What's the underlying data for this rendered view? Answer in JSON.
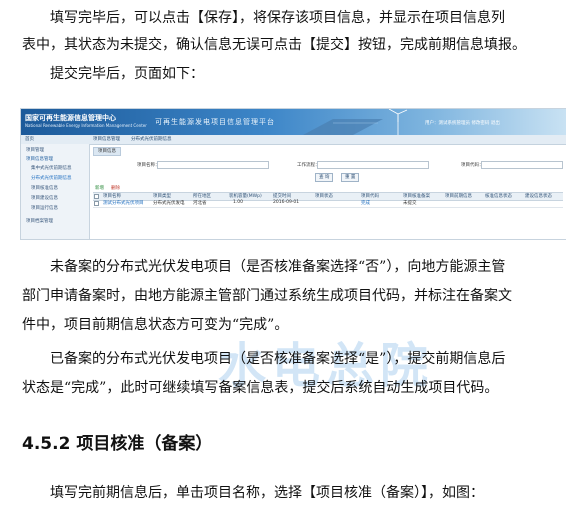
{
  "paragraphs": {
    "p1_line1": "填写完毕后，可以点击【保存】，将保存该项目信息，并显示在项目信息列",
    "p1_line2": "表中，其状态为未提交，确认信息无误可点击【提交】按钮，完成前期信息填报。",
    "p2": "提交完毕后，页面如下：",
    "p3_line1": "未备案的分布式光伏发电项目（是否核准备案选择“否”），向地方能源主管",
    "p3_line2": "部门申请备案时，由地方能源主管部门通过系统生成项目代码，并标注在备案文",
    "p3_line3": "件中，项目前期信息状态方可变为“完成”。",
    "p4_line1": "已备案的分布式光伏发电项目（是否核准备案选择“是”），提交前期信息后",
    "p4_line2": "状态是“完成”，此时可继续填写备案信息表，提交后系统自动生成项目代码。",
    "heading": "4.5.2 项目核准（备案）",
    "p5": "填写完前期信息后，单击项目名称，选择【项目核准（备案）】，如图："
  },
  "watermark": "水电总院",
  "screenshot": {
    "banner_title": "国家可再生能源信息管理中心",
    "banner_subtitle": "National Renewable Energy Information Management Center",
    "banner_slogan": "可再生能源发电项目信息管理平台",
    "banner_user": "用户：测试系统管理员",
    "banner_links": "修改密码  退出",
    "nav_home": "首页",
    "nav_info": "项目信息管理",
    "nav_current": "分布式光伏前期信息",
    "sidebar": [
      {
        "label": "项目管理",
        "state": "header"
      },
      {
        "label": "项目信息管理",
        "state": "header"
      },
      {
        "label": "集中式光伏前期信息",
        "state": "sub"
      },
      {
        "label": "分布式光伏前期信息",
        "state": "active"
      },
      {
        "label": "项目核准信息",
        "state": "sub"
      },
      {
        "label": "项目建设信息",
        "state": "sub"
      },
      {
        "label": "项目运行信息",
        "state": "sub"
      },
      {
        "label": "项目档案管理",
        "state": "header"
      }
    ],
    "tab": "项目信息",
    "query_labels": [
      "项目名称：",
      "工作流程：",
      "项目代码："
    ],
    "buttons": [
      "查 询",
      "重 置"
    ],
    "ops": [
      "新增",
      "删除"
    ],
    "columns": [
      "项目名称",
      "项目类型",
      "所在地区",
      "装机容量(MWp)",
      "提交时间",
      "项目状态",
      "项目代码",
      "项目核准备案",
      "项目前期信息",
      "核准信息状态",
      "建设信息状态"
    ],
    "row": [
      "测试分布式光伏项目",
      "分布式光伏发电",
      "河北省",
      "1.00",
      "2016-09-01",
      "完成",
      "",
      "未提交",
      "",
      "",
      ""
    ]
  }
}
